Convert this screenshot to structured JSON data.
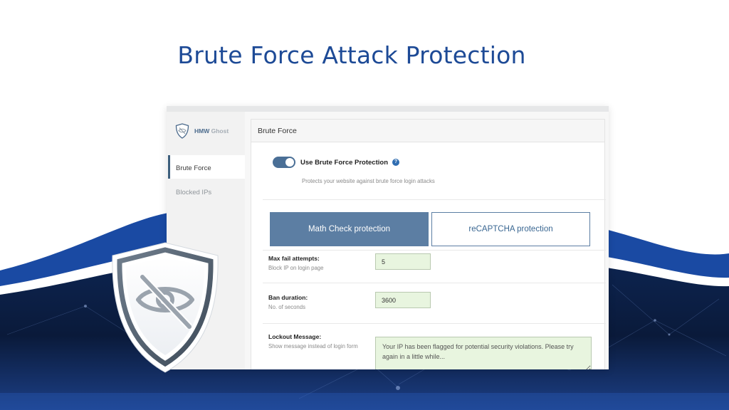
{
  "headline": "Brute Force Attack Protection",
  "colors": {
    "headline": "#1d4a96",
    "wave_blue": "#1a4aa3",
    "dark_navy": "#0a1a3c",
    "toggle_on": "#4a6f96",
    "tab_active": "#5c7ea3",
    "input_bg": "#e8f5df"
  },
  "sidebar": {
    "logo_icon": "shield-eye-slash-icon",
    "brand_name": "HMW",
    "brand_suffix": "Ghost",
    "items": [
      {
        "label": "Brute Force",
        "active": true
      },
      {
        "label": "Blocked IPs",
        "active": false
      }
    ]
  },
  "card": {
    "title": "Brute Force",
    "toggle": {
      "label": "Use Brute Force Protection",
      "enabled": true,
      "help_icon": "question-circle-icon",
      "help_glyph": "?",
      "description": "Protects your website against brute force login attacks"
    },
    "tabs": [
      {
        "label": "Math Check protection",
        "active": true
      },
      {
        "label": "reCAPTCHA protection",
        "active": false
      }
    ],
    "fields": {
      "max_fail": {
        "label": "Max fail attempts:",
        "sub": "Block IP on login page",
        "value": "5"
      },
      "ban_duration": {
        "label": "Ban duration:",
        "sub": "No. of seconds",
        "value": "3600"
      },
      "lockout": {
        "label": "Lockout Message:",
        "sub": "Show message instead of login form",
        "value": "Your IP has been flagged for potential security violations. Please try again in a little while..."
      }
    }
  },
  "badge_icon": "eye-slash-shield-icon"
}
